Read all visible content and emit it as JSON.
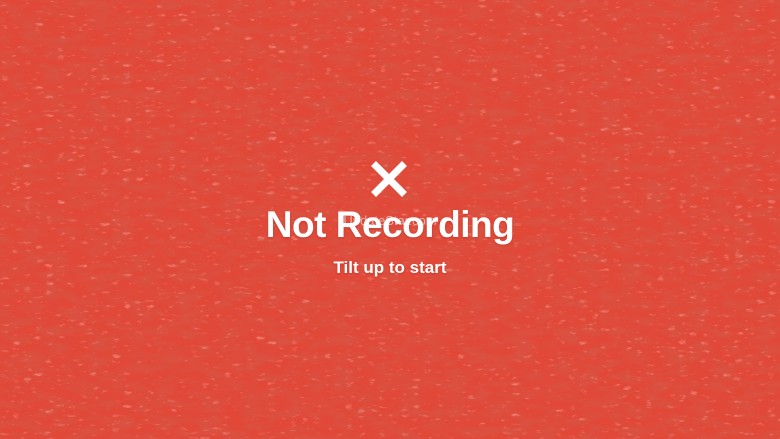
{
  "background": {
    "texture": "grass",
    "color": "#e24a3b"
  },
  "status": {
    "icon": "close-icon",
    "title": "Not Recording",
    "hint": "Tilt up to start",
    "text_color": "#ffffff"
  },
  "watermark": {
    "text": "UpdateStar.com"
  }
}
